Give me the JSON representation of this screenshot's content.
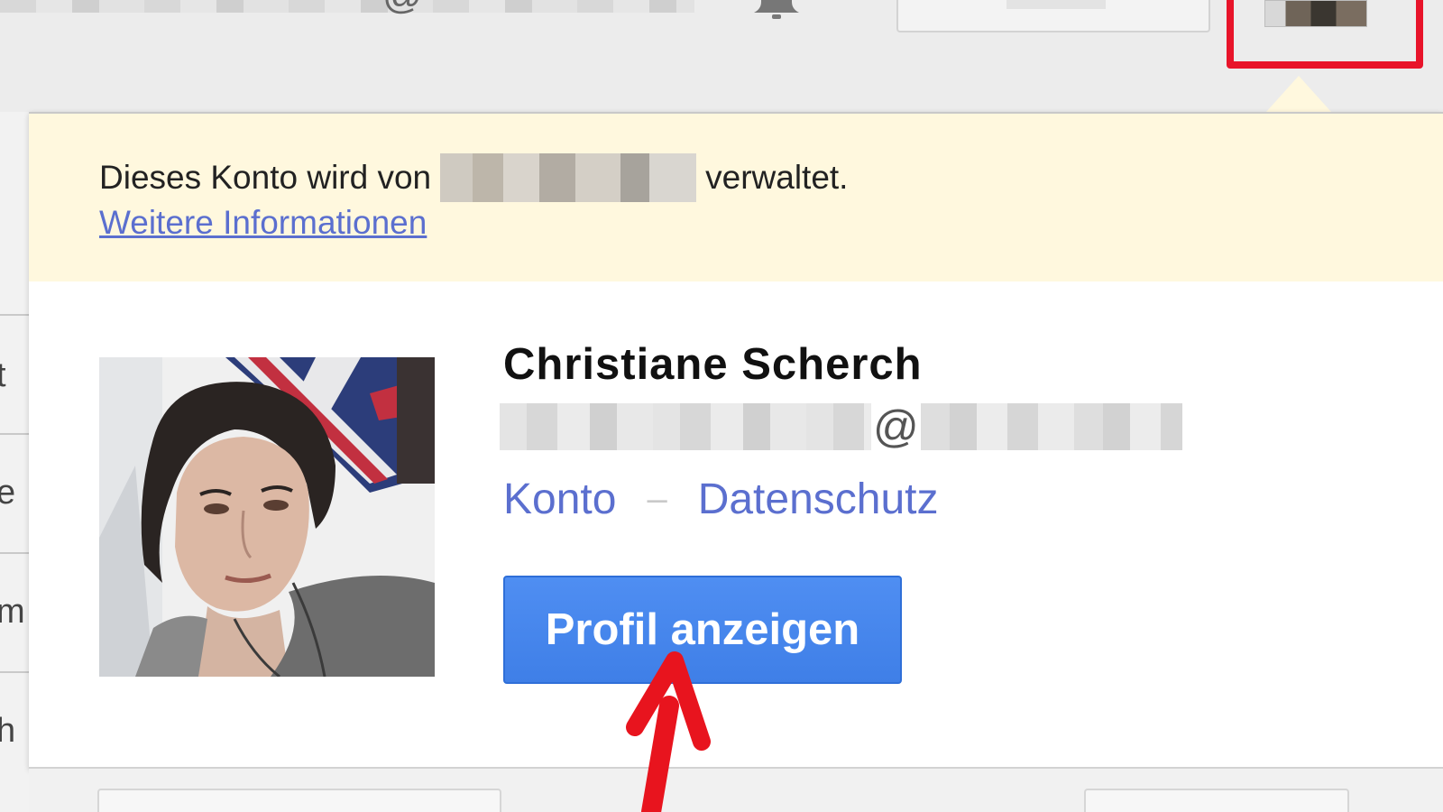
{
  "notice": {
    "prefix": "Dieses Konto wird von",
    "suffix": "verwaltet.",
    "more_info_link": "Weitere Informationen"
  },
  "profile": {
    "name": "Christiane Scherch",
    "email_at": "@",
    "links": {
      "account": "Konto",
      "separator": "–",
      "privacy": "Datenschutz"
    },
    "view_profile_button": "Profil anzeigen"
  },
  "left_strip_letters": [
    "t",
    "e",
    "m",
    "h"
  ],
  "colors": {
    "notice_bg": "#fff8de",
    "link": "#5b6fcf",
    "button": "#4285f4",
    "highlight": "#e8142a"
  },
  "icons": {
    "notifications": "bell-icon",
    "annotation": "red-arrow-icon"
  }
}
